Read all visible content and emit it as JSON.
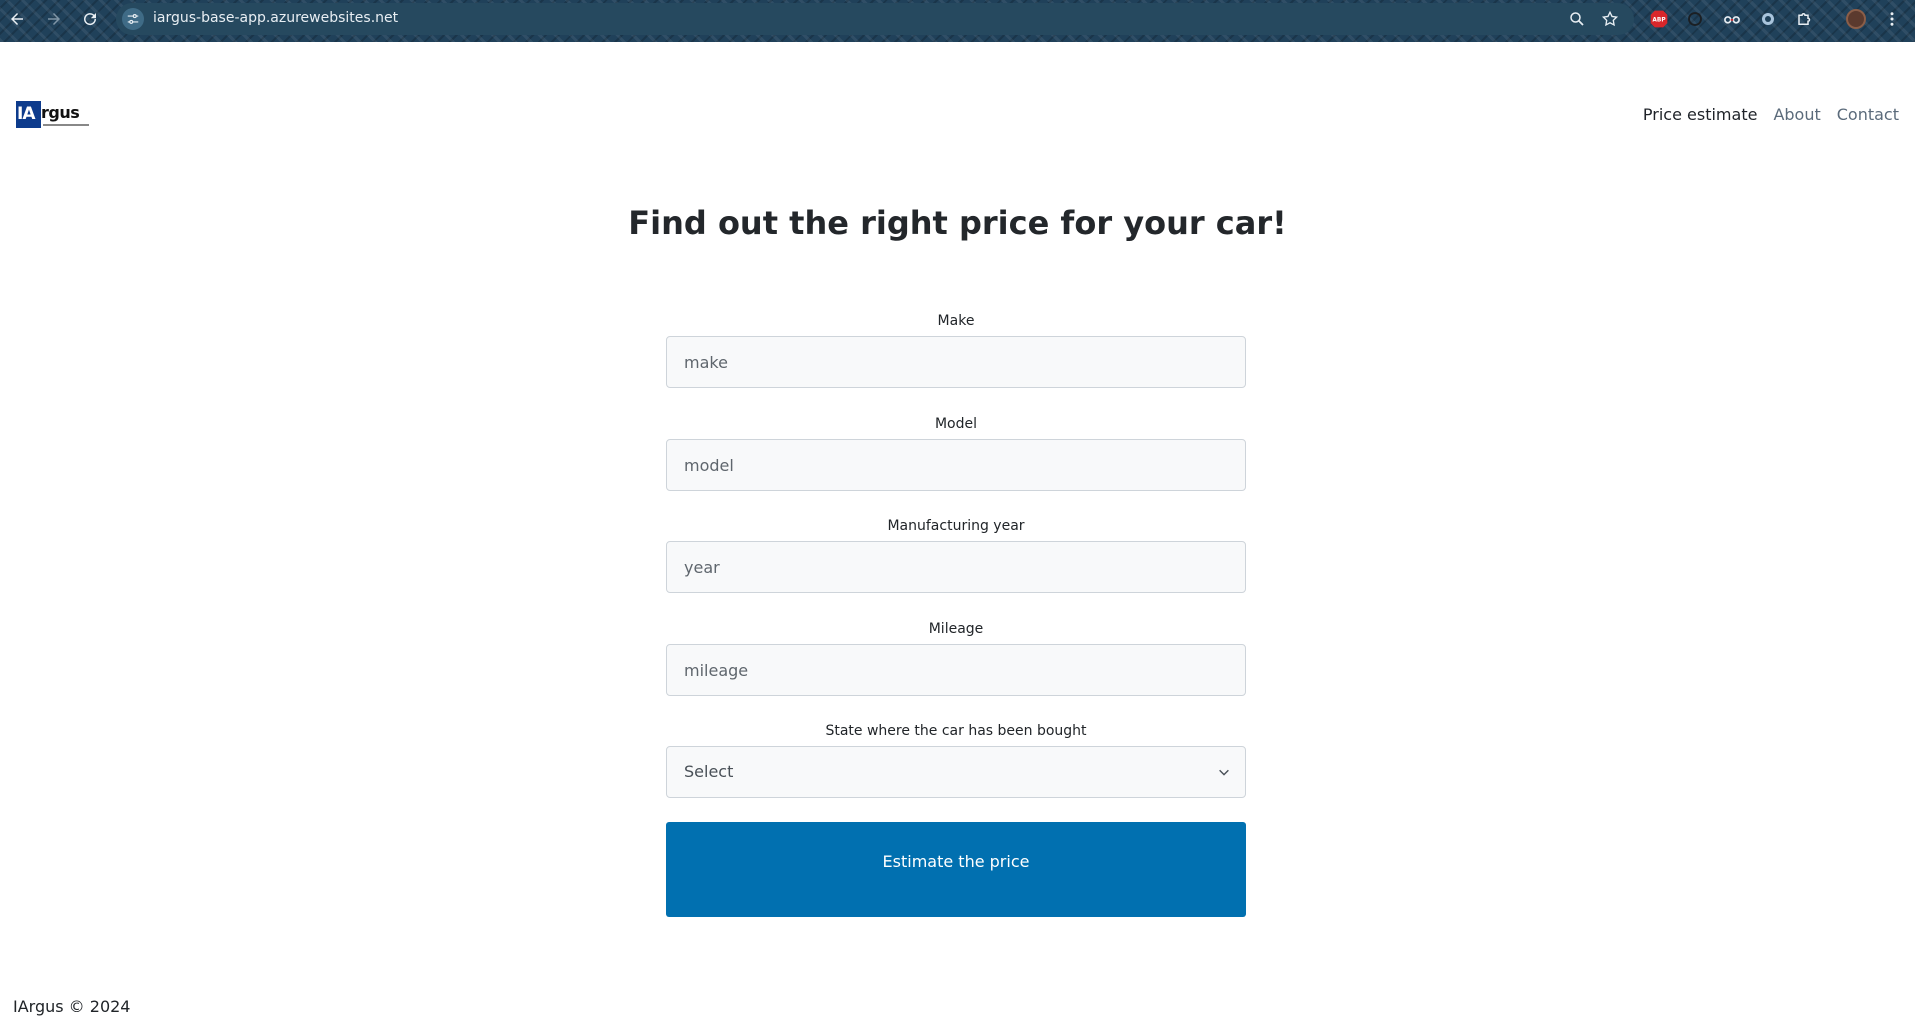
{
  "browser": {
    "url": "iargus-base-app.azurewebsites.net",
    "extensions": [
      "adblock-plus-icon",
      "extension-circle-icon",
      "glasses-icon",
      "extension-ring-icon",
      "puzzle-icon",
      "profile-avatar"
    ],
    "adblock_label": "ABP"
  },
  "site": {
    "logo": {
      "prefix": "IA",
      "suffix": "rgus"
    },
    "nav": [
      {
        "label": "Price estimate",
        "active": true
      },
      {
        "label": "About",
        "active": false
      },
      {
        "label": "Contact",
        "active": false
      }
    ]
  },
  "main": {
    "headline": "Find out the right price for your car!",
    "fields": {
      "make": {
        "label": "Make",
        "placeholder": "make"
      },
      "model": {
        "label": "Model",
        "placeholder": "model"
      },
      "year": {
        "label": "Manufacturing year",
        "placeholder": "year"
      },
      "mileage": {
        "label": "Mileage",
        "placeholder": "mileage"
      },
      "state": {
        "label": "State where the car has been bought",
        "value": "Select"
      }
    },
    "submit_label": "Estimate the price"
  },
  "footer": {
    "text": "IArgus © 2024"
  },
  "colors": {
    "accent": "#0170b0",
    "logo_blue": "#0d3b8c",
    "chrome": "#20415a"
  }
}
